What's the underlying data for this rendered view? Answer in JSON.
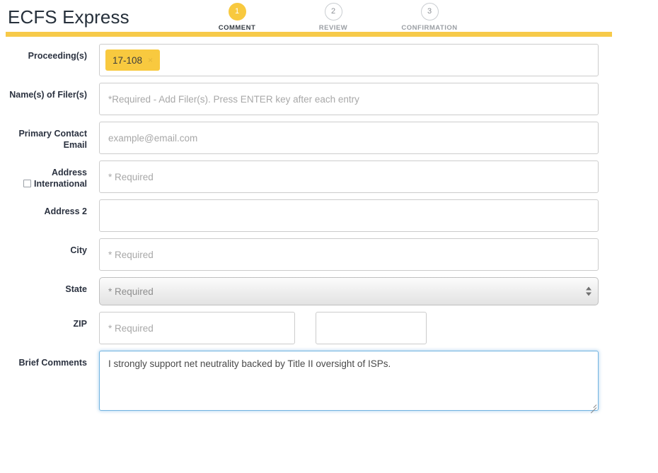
{
  "header": {
    "app_title": "ECFS Express",
    "accent_color": "#f7ca49",
    "steps": [
      {
        "number": "1",
        "label": "COMMENT",
        "state": "active"
      },
      {
        "number": "2",
        "label": "REVIEW",
        "state": "inactive"
      },
      {
        "number": "3",
        "label": "CONFIRMATION",
        "state": "inactive"
      }
    ]
  },
  "form": {
    "proceedings": {
      "label": "Proceeding(s)",
      "tags": [
        {
          "text": "17-108",
          "remove_icon": "×"
        }
      ]
    },
    "filers": {
      "label": "Name(s) of Filer(s)",
      "value": "",
      "placeholder": "*Required - Add Filer(s). Press ENTER key after each entry"
    },
    "email": {
      "label_line1": "Primary Contact",
      "label_line2": "Email",
      "value": "",
      "placeholder": "example@email.com"
    },
    "address": {
      "label_line1": "Address",
      "label_line2": "International",
      "international_checked": false,
      "value": "",
      "placeholder": "* Required"
    },
    "address2": {
      "label": "Address 2",
      "value": "",
      "placeholder": ""
    },
    "city": {
      "label": "City",
      "value": "",
      "placeholder": "* Required"
    },
    "state": {
      "label": "State",
      "selected": "* Required",
      "options": [
        "* Required"
      ]
    },
    "zip": {
      "label": "ZIP",
      "primary": {
        "value": "",
        "placeholder": "* Required"
      },
      "extension": {
        "value": "",
        "placeholder": ""
      }
    },
    "comments": {
      "label": "Brief Comments",
      "value": "I strongly support net neutrality backed by Title II oversight of ISPs.",
      "placeholder": "",
      "focused": true
    }
  }
}
